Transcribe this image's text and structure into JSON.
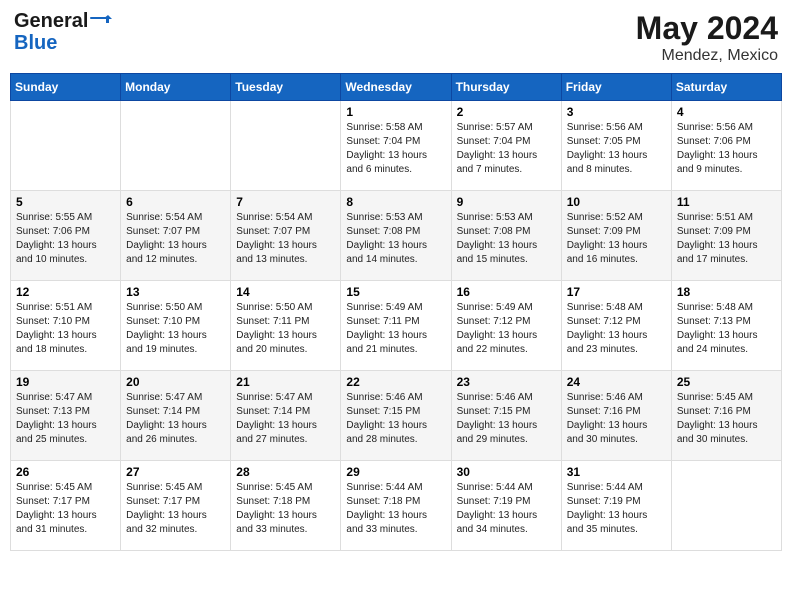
{
  "header": {
    "logo_line1": "General",
    "logo_line2": "Blue",
    "month_year": "May 2024",
    "location": "Mendez, Mexico"
  },
  "weekdays": [
    "Sunday",
    "Monday",
    "Tuesday",
    "Wednesday",
    "Thursday",
    "Friday",
    "Saturday"
  ],
  "weeks": [
    [
      {
        "day": "",
        "info": ""
      },
      {
        "day": "",
        "info": ""
      },
      {
        "day": "",
        "info": ""
      },
      {
        "day": "1",
        "info": "Sunrise: 5:58 AM\nSunset: 7:04 PM\nDaylight: 13 hours\nand 6 minutes."
      },
      {
        "day": "2",
        "info": "Sunrise: 5:57 AM\nSunset: 7:04 PM\nDaylight: 13 hours\nand 7 minutes."
      },
      {
        "day": "3",
        "info": "Sunrise: 5:56 AM\nSunset: 7:05 PM\nDaylight: 13 hours\nand 8 minutes."
      },
      {
        "day": "4",
        "info": "Sunrise: 5:56 AM\nSunset: 7:06 PM\nDaylight: 13 hours\nand 9 minutes."
      }
    ],
    [
      {
        "day": "5",
        "info": "Sunrise: 5:55 AM\nSunset: 7:06 PM\nDaylight: 13 hours\nand 10 minutes."
      },
      {
        "day": "6",
        "info": "Sunrise: 5:54 AM\nSunset: 7:07 PM\nDaylight: 13 hours\nand 12 minutes."
      },
      {
        "day": "7",
        "info": "Sunrise: 5:54 AM\nSunset: 7:07 PM\nDaylight: 13 hours\nand 13 minutes."
      },
      {
        "day": "8",
        "info": "Sunrise: 5:53 AM\nSunset: 7:08 PM\nDaylight: 13 hours\nand 14 minutes."
      },
      {
        "day": "9",
        "info": "Sunrise: 5:53 AM\nSunset: 7:08 PM\nDaylight: 13 hours\nand 15 minutes."
      },
      {
        "day": "10",
        "info": "Sunrise: 5:52 AM\nSunset: 7:09 PM\nDaylight: 13 hours\nand 16 minutes."
      },
      {
        "day": "11",
        "info": "Sunrise: 5:51 AM\nSunset: 7:09 PM\nDaylight: 13 hours\nand 17 minutes."
      }
    ],
    [
      {
        "day": "12",
        "info": "Sunrise: 5:51 AM\nSunset: 7:10 PM\nDaylight: 13 hours\nand 18 minutes."
      },
      {
        "day": "13",
        "info": "Sunrise: 5:50 AM\nSunset: 7:10 PM\nDaylight: 13 hours\nand 19 minutes."
      },
      {
        "day": "14",
        "info": "Sunrise: 5:50 AM\nSunset: 7:11 PM\nDaylight: 13 hours\nand 20 minutes."
      },
      {
        "day": "15",
        "info": "Sunrise: 5:49 AM\nSunset: 7:11 PM\nDaylight: 13 hours\nand 21 minutes."
      },
      {
        "day": "16",
        "info": "Sunrise: 5:49 AM\nSunset: 7:12 PM\nDaylight: 13 hours\nand 22 minutes."
      },
      {
        "day": "17",
        "info": "Sunrise: 5:48 AM\nSunset: 7:12 PM\nDaylight: 13 hours\nand 23 minutes."
      },
      {
        "day": "18",
        "info": "Sunrise: 5:48 AM\nSunset: 7:13 PM\nDaylight: 13 hours\nand 24 minutes."
      }
    ],
    [
      {
        "day": "19",
        "info": "Sunrise: 5:47 AM\nSunset: 7:13 PM\nDaylight: 13 hours\nand 25 minutes."
      },
      {
        "day": "20",
        "info": "Sunrise: 5:47 AM\nSunset: 7:14 PM\nDaylight: 13 hours\nand 26 minutes."
      },
      {
        "day": "21",
        "info": "Sunrise: 5:47 AM\nSunset: 7:14 PM\nDaylight: 13 hours\nand 27 minutes."
      },
      {
        "day": "22",
        "info": "Sunrise: 5:46 AM\nSunset: 7:15 PM\nDaylight: 13 hours\nand 28 minutes."
      },
      {
        "day": "23",
        "info": "Sunrise: 5:46 AM\nSunset: 7:15 PM\nDaylight: 13 hours\nand 29 minutes."
      },
      {
        "day": "24",
        "info": "Sunrise: 5:46 AM\nSunset: 7:16 PM\nDaylight: 13 hours\nand 30 minutes."
      },
      {
        "day": "25",
        "info": "Sunrise: 5:45 AM\nSunset: 7:16 PM\nDaylight: 13 hours\nand 30 minutes."
      }
    ],
    [
      {
        "day": "26",
        "info": "Sunrise: 5:45 AM\nSunset: 7:17 PM\nDaylight: 13 hours\nand 31 minutes."
      },
      {
        "day": "27",
        "info": "Sunrise: 5:45 AM\nSunset: 7:17 PM\nDaylight: 13 hours\nand 32 minutes."
      },
      {
        "day": "28",
        "info": "Sunrise: 5:45 AM\nSunset: 7:18 PM\nDaylight: 13 hours\nand 33 minutes."
      },
      {
        "day": "29",
        "info": "Sunrise: 5:44 AM\nSunset: 7:18 PM\nDaylight: 13 hours\nand 33 minutes."
      },
      {
        "day": "30",
        "info": "Sunrise: 5:44 AM\nSunset: 7:19 PM\nDaylight: 13 hours\nand 34 minutes."
      },
      {
        "day": "31",
        "info": "Sunrise: 5:44 AM\nSunset: 7:19 PM\nDaylight: 13 hours\nand 35 minutes."
      },
      {
        "day": "",
        "info": ""
      }
    ]
  ]
}
